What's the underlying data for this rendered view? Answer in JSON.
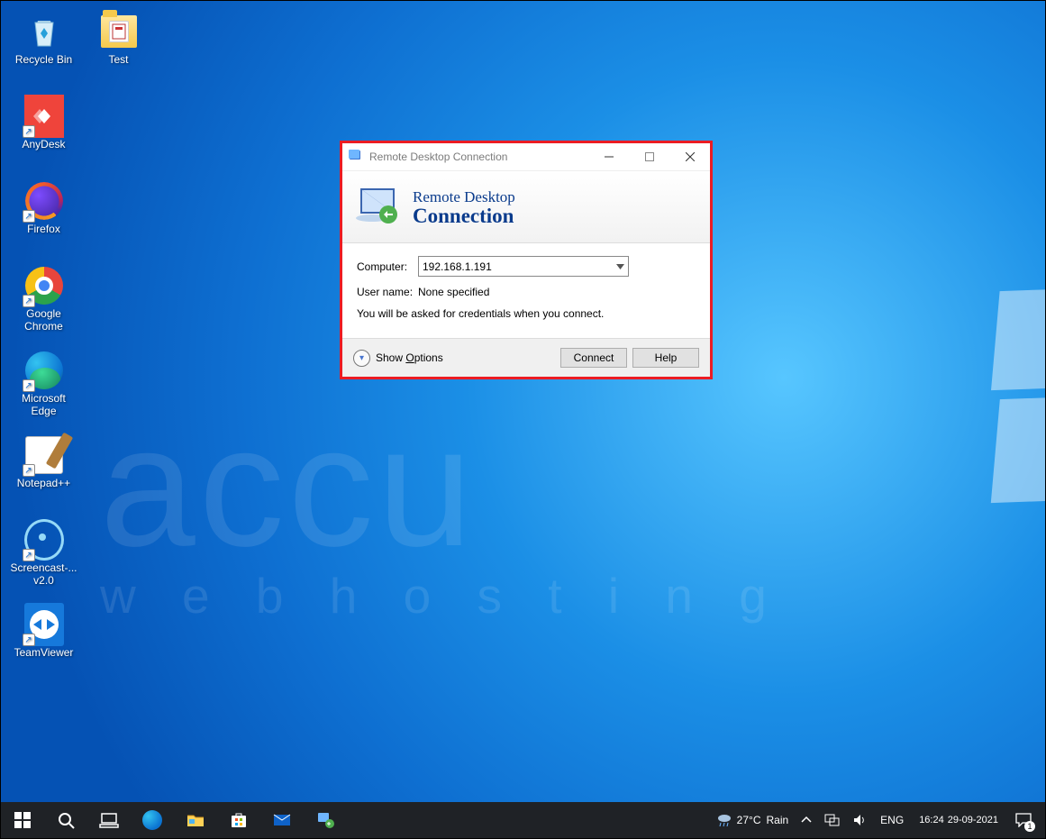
{
  "desktop_icons": [
    {
      "id": "recycle",
      "label": "Recycle Bin",
      "shortcut": false
    },
    {
      "id": "test",
      "label": "Test",
      "shortcut": false
    },
    {
      "id": "anydesk",
      "label": "AnyDesk",
      "shortcut": true
    },
    {
      "id": "firefox",
      "label": "Firefox",
      "shortcut": true
    },
    {
      "id": "chrome",
      "label": "Google\nChrome",
      "shortcut": true
    },
    {
      "id": "edge",
      "label": "Microsoft\nEdge",
      "shortcut": true
    },
    {
      "id": "npp",
      "label": "Notepad++",
      "shortcut": true
    },
    {
      "id": "scast",
      "label": "Screencast-...\nv2.0",
      "shortcut": true
    },
    {
      "id": "tv",
      "label": "TeamViewer",
      "shortcut": true
    }
  ],
  "rdc": {
    "window_title": "Remote Desktop Connection",
    "banner_line1": "Remote Desktop",
    "banner_line2": "Connection",
    "labels": {
      "computer": "Computer:",
      "username": "User name:"
    },
    "computer_value": "192.168.1.191",
    "username_value": "None specified",
    "note": "You will be asked for credentials when you connect.",
    "show_options": "Show Options",
    "connect": "Connect",
    "help": "Help"
  },
  "taskbar": {
    "weather_temp": "27°C",
    "weather_cond": "Rain",
    "lang": "ENG",
    "time": "16:24",
    "date": "29-09-2021",
    "notif_count": "1"
  },
  "watermark": {
    "line1": "accu",
    "line2": "w e b   h o s t i n g"
  }
}
